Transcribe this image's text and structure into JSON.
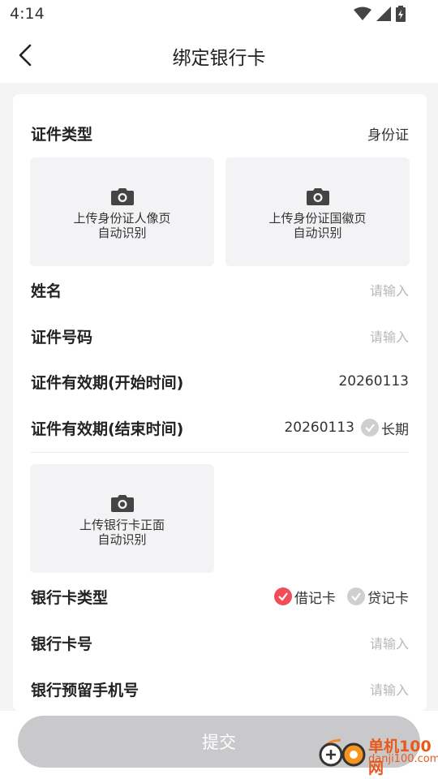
{
  "status": {
    "time": "4:14"
  },
  "header": {
    "title": "绑定银行卡"
  },
  "form": {
    "id_type": {
      "label": "证件类型",
      "value": "身份证"
    },
    "upload_front": {
      "line1": "上传身份证人像页",
      "line2": "自动识别"
    },
    "upload_back": {
      "line1": "上传身份证国徽页",
      "line2": "自动识别"
    },
    "name": {
      "label": "姓名",
      "placeholder": "请输入"
    },
    "id_number": {
      "label": "证件号码",
      "placeholder": "请输入"
    },
    "valid_start": {
      "label": "证件有效期(开始时间)",
      "value": "20260113"
    },
    "valid_end": {
      "label": "证件有效期(结束时间)",
      "value": "20260113",
      "long_term": "长期"
    },
    "upload_bank": {
      "line1": "上传银行卡正面",
      "line2": "自动识别"
    },
    "card_type": {
      "label": "银行卡类型",
      "debit": "借记卡",
      "credit": "贷记卡",
      "selected": "借记卡"
    },
    "card_number": {
      "label": "银行卡号",
      "placeholder": "请输入"
    },
    "phone": {
      "label": "银行预留手机号",
      "placeholder": "请输入"
    }
  },
  "submit_label": "提交",
  "watermark": {
    "name": "单机100网",
    "url": "danji100.com"
  },
  "colors": {
    "accent": "#f04d57",
    "disabled_button": "#c9c9cc",
    "placeholder": "#b7b7b7"
  }
}
